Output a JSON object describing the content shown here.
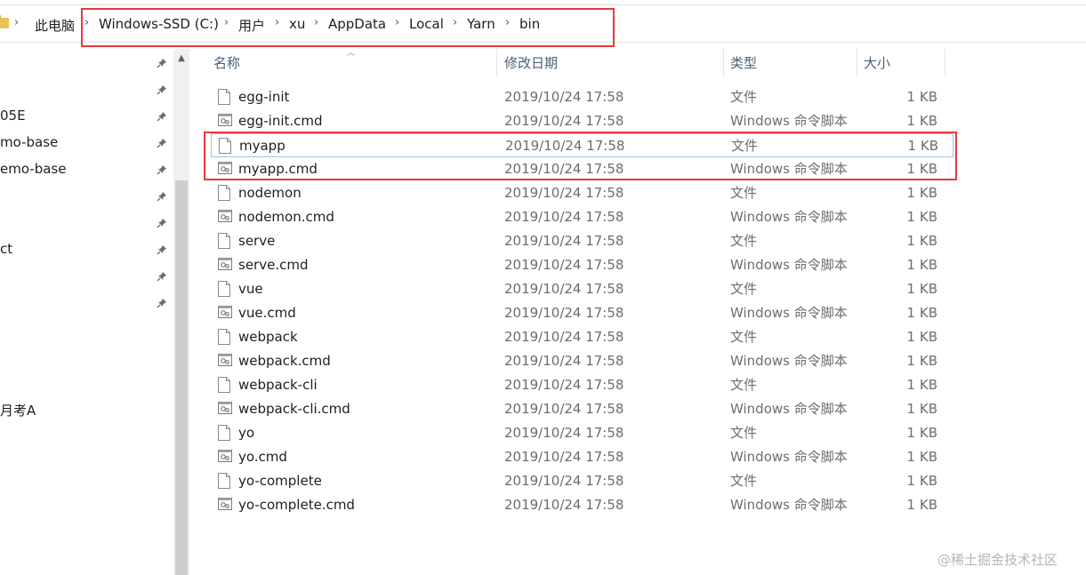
{
  "address_bar": {
    "crumbs": [
      "此电脑",
      "Windows-SSD (C:)",
      "用户",
      "xu",
      "AppData",
      "Local",
      "Yarn",
      "bin"
    ],
    "separator": "›"
  },
  "nav_pane": {
    "items": [
      "05E",
      "mo-base",
      "emo-base",
      "ct",
      "月考A"
    ],
    "scroll_up_icon": "chevron-up-icon",
    "pin_icon": "pin-icon"
  },
  "columns": {
    "name": "名称",
    "date": "修改日期",
    "type": "类型",
    "size": "大小"
  },
  "files": [
    {
      "name": "egg-init",
      "date": "2019/10/24 17:58",
      "type": "文件",
      "size": "1 KB",
      "icon": "file-icon"
    },
    {
      "name": "egg-init.cmd",
      "date": "2019/10/24 17:58",
      "type": "Windows 命令脚本",
      "size": "1 KB",
      "icon": "cmd-script-icon"
    },
    {
      "name": "myapp",
      "date": "2019/10/24 17:58",
      "type": "文件",
      "size": "1 KB",
      "icon": "file-icon"
    },
    {
      "name": "myapp.cmd",
      "date": "2019/10/24 17:58",
      "type": "Windows 命令脚本",
      "size": "1 KB",
      "icon": "cmd-script-icon"
    },
    {
      "name": "nodemon",
      "date": "2019/10/24 17:58",
      "type": "文件",
      "size": "1 KB",
      "icon": "file-icon"
    },
    {
      "name": "nodemon.cmd",
      "date": "2019/10/24 17:58",
      "type": "Windows 命令脚本",
      "size": "1 KB",
      "icon": "cmd-script-icon"
    },
    {
      "name": "serve",
      "date": "2019/10/24 17:58",
      "type": "文件",
      "size": "1 KB",
      "icon": "file-icon"
    },
    {
      "name": "serve.cmd",
      "date": "2019/10/24 17:58",
      "type": "Windows 命令脚本",
      "size": "1 KB",
      "icon": "cmd-script-icon"
    },
    {
      "name": "vue",
      "date": "2019/10/24 17:58",
      "type": "文件",
      "size": "1 KB",
      "icon": "file-icon"
    },
    {
      "name": "vue.cmd",
      "date": "2019/10/24 17:58",
      "type": "Windows 命令脚本",
      "size": "1 KB",
      "icon": "cmd-script-icon"
    },
    {
      "name": "webpack",
      "date": "2019/10/24 17:58",
      "type": "文件",
      "size": "1 KB",
      "icon": "file-icon"
    },
    {
      "name": "webpack.cmd",
      "date": "2019/10/24 17:58",
      "type": "Windows 命令脚本",
      "size": "1 KB",
      "icon": "cmd-script-icon"
    },
    {
      "name": "webpack-cli",
      "date": "2019/10/24 17:58",
      "type": "文件",
      "size": "1 KB",
      "icon": "file-icon"
    },
    {
      "name": "webpack-cli.cmd",
      "date": "2019/10/24 17:58",
      "type": "Windows 命令脚本",
      "size": "1 KB",
      "icon": "cmd-script-icon"
    },
    {
      "name": "yo",
      "date": "2019/10/24 17:58",
      "type": "文件",
      "size": "1 KB",
      "icon": "file-icon"
    },
    {
      "name": "yo.cmd",
      "date": "2019/10/24 17:58",
      "type": "Windows 命令脚本",
      "size": "1 KB",
      "icon": "cmd-script-icon"
    },
    {
      "name": "yo-complete",
      "date": "2019/10/24 17:58",
      "type": "文件",
      "size": "1 KB",
      "icon": "file-icon"
    },
    {
      "name": "yo-complete.cmd",
      "date": "2019/10/24 17:58",
      "type": "Windows 命令脚本",
      "size": "1 KB",
      "icon": "cmd-script-icon"
    }
  ],
  "focused_file": "myapp",
  "watermark": "@稀土掘金技术社区",
  "colors": {
    "annotation_red": "#e8383d",
    "focus_border": "#9ac6ea",
    "header_text": "#4c607a",
    "secondary_text": "#6d6d6d"
  }
}
